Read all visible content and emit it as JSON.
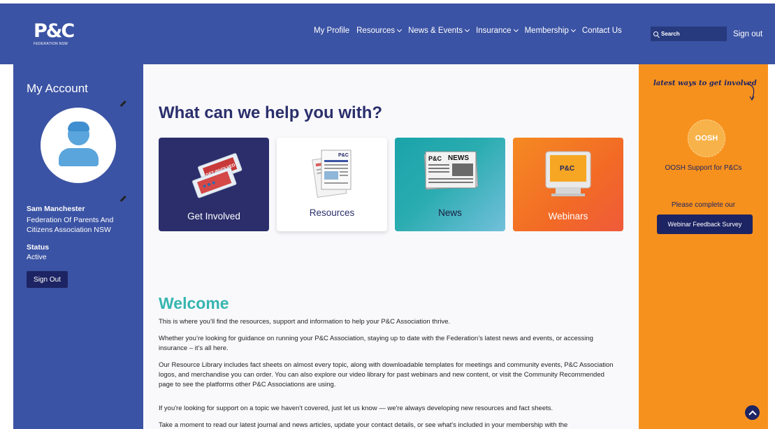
{
  "header": {
    "logo_text": "P&C",
    "logo_subtitle": "FEDERATION NSW",
    "nav": [
      {
        "label": "My Profile",
        "dropdown": false
      },
      {
        "label": "Resources",
        "dropdown": true
      },
      {
        "label": "News & Events",
        "dropdown": true
      },
      {
        "label": "Insurance",
        "dropdown": true
      },
      {
        "label": "Membership",
        "dropdown": true
      },
      {
        "label": "Contact Us",
        "dropdown": false
      }
    ],
    "search_placeholder": "Search",
    "signout": "Sign out"
  },
  "account": {
    "title": "My Account",
    "name": "Sam Manchester",
    "org": "Federation Of Parents And Citizens Association NSW",
    "status_label": "Status",
    "status_value": "Active",
    "signout_button": "Sign Out"
  },
  "main": {
    "help_title": "What can we help you with?",
    "cards": [
      {
        "label": "Get Involved"
      },
      {
        "label": "Resources"
      },
      {
        "label": "News"
      },
      {
        "label": "Webinars"
      }
    ],
    "card_image_text": {
      "ticket": "GET INVOLVED",
      "doc": "P&C",
      "news_logo": "P&C",
      "news_title": "NEWS",
      "screen_logo": "P&C"
    },
    "welcome_title": "Welcome",
    "paragraphs": [
      "This is where you’ll find the resources, support and information to help your P&C Association thrive.",
      "Whether you’re looking for guidance on running your P&C Association, staying up to date with the Federation’s latest news and events, or accessing insurance – it’s all here.",
      "Our Resource Library includes fact sheets on almost every topic, along with downloadable templates for meetings and community events, P&C Association logos, and merchandise you can order. You can also explore our video library for past webinars and new content, or visit the Community Recommended page to see the platforms other P&C Associations are using.",
      "If you're looking for support on a topic we haven't covered, just let us know — we're always developing new resources and fact sheets.",
      "Take a moment to read our latest journal and news articles, update your contact details, or see what's included in your membership with the"
    ]
  },
  "sidebar_right": {
    "latest": "latest ways to get involved",
    "oosh_badge": "OOSH",
    "oosh_caption": "OOSH Support for P&Cs",
    "please_text": "Please complete our",
    "survey_button": "Webinar Feedback Survey"
  },
  "colors": {
    "brand_blue": "#3b53a4",
    "navy": "#1d2463",
    "teal": "#36b5b0",
    "orange": "#f7911e"
  },
  "icons": [
    "pencil-icon",
    "search-icon",
    "chevron-down-icon",
    "avatar-icon",
    "arrow-up-icon"
  ]
}
